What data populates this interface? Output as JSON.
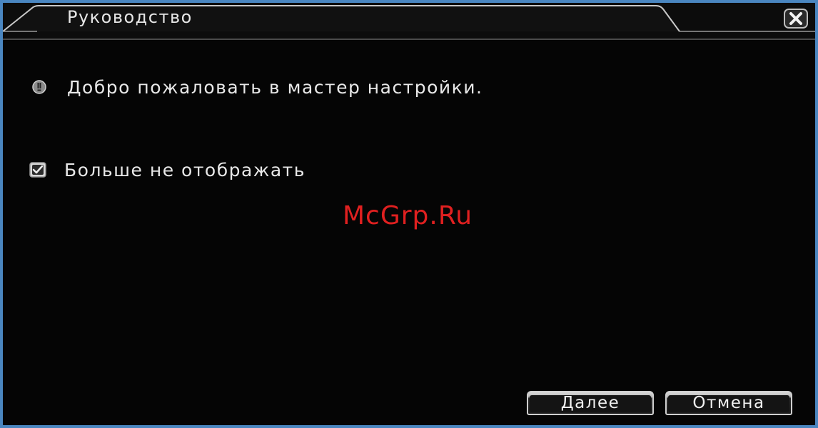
{
  "window": {
    "title": "Руководство",
    "close_icon": "close-icon"
  },
  "main": {
    "info_icon": "info-icon",
    "welcome_text": "Добро пожаловать в мастер настройки.",
    "checkbox": {
      "label": "Больше не отображать",
      "checked": true
    }
  },
  "watermark": "McGrp.Ru",
  "buttons": {
    "next_label": "Далее",
    "cancel_label": "Отмена"
  },
  "colors": {
    "frame": "#4a86c0",
    "background": "#050505",
    "text": "#e8e8e8",
    "watermark": "#e02020"
  }
}
